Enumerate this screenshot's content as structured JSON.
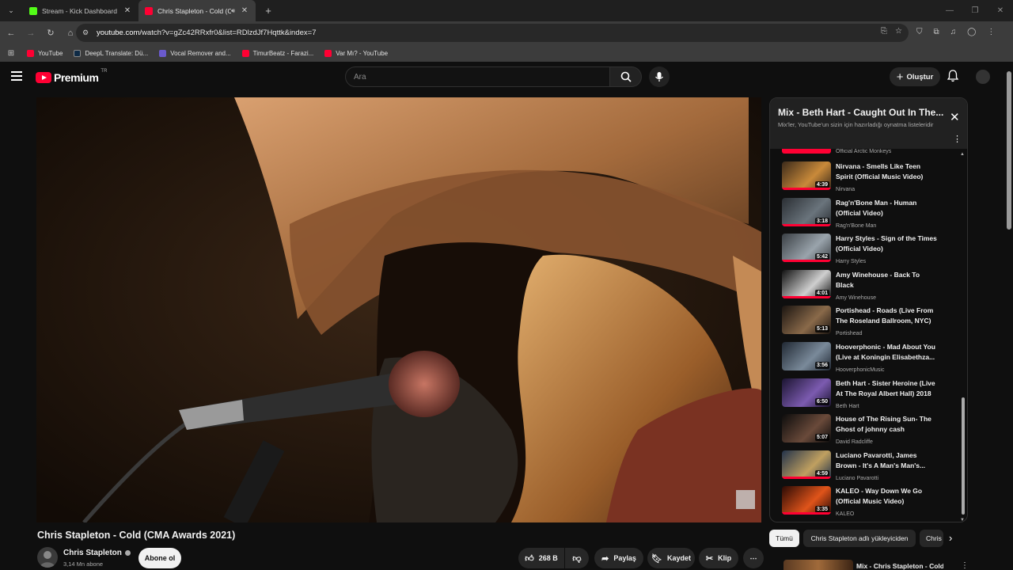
{
  "browser": {
    "tabs": [
      {
        "title": "Stream - Kick Dashboard",
        "color": "#53fc18"
      },
      {
        "title": "Chris Stapleton - Cold (CM",
        "color": "#ff0033",
        "active": true
      }
    ],
    "url_host": "youtube.com",
    "url_path": "/watch?v=gZc42RRxfr0&list=RDlzdJf7Hqttk&index=7",
    "bookmarks": [
      {
        "label": "YouTube",
        "color": "#ff0033"
      },
      {
        "label": "DeepL Translate: Dü...",
        "color": "#0f2b46"
      },
      {
        "label": "Vocal Remover and...",
        "color": "#6a5acd"
      },
      {
        "label": "TimurBeatz - Farazi...",
        "color": "#ff0033"
      },
      {
        "label": "Var Mı? - YouTube",
        "color": "#ff0033"
      }
    ]
  },
  "youtube": {
    "logo_text": "Premium",
    "country": "TR",
    "search_placeholder": "Ara",
    "create_label": "Oluştur"
  },
  "video": {
    "title": "Chris Stapleton - Cold (CMA Awards 2021)",
    "channel": "Chris Stapleton",
    "subscribers": "3,14 Mn abone",
    "subscribe_label": "Abone ol",
    "likes": "268 B",
    "share_label": "Paylaş",
    "save_label": "Kaydet",
    "clip_label": "Klip"
  },
  "playlist": {
    "title": "Mix - Beth Hart - Caught Out In The...",
    "subtitle": "Mix'ler, YouTube'un sizin için hazırladığı oynatma listeleridir",
    "partial_channel": "Official Arctic Monkeys",
    "items": [
      {
        "title": "Nirvana - Smells Like Teen Spirit (Official Music Video)",
        "channel": "Nirvana",
        "duration": "4:39",
        "progress": 1.0
      },
      {
        "title": "Rag'n'Bone Man - Human (Official Video)",
        "channel": "Rag'n'Bone Man",
        "duration": "3:18",
        "progress": 1.0
      },
      {
        "title": "Harry Styles - Sign of the Times (Official Video)",
        "channel": "Harry Styles",
        "duration": "5:42",
        "progress": 1.0
      },
      {
        "title": "Amy Winehouse - Back To Black",
        "channel": "Amy Winehouse",
        "duration": "4:01",
        "progress": 1.0
      },
      {
        "title": "Portishead - Roads (Live From The Roseland Ballroom, NYC)",
        "channel": "Portishead",
        "duration": "5:13",
        "progress": 0.0
      },
      {
        "title": "Hooverphonic - Mad About You (Live at Koningin Elisabethza...",
        "channel": "HooverphonicMusic",
        "duration": "3:56",
        "progress": 0.0
      },
      {
        "title": "Beth Hart - Sister Heroine (Live At The Royal Albert Hall) 2018",
        "channel": "Beth Hart",
        "duration": "6:50",
        "progress": 0.0
      },
      {
        "title": "House of The Rising Sun- The Ghost of johnny cash",
        "channel": "David Radcliffe",
        "duration": "5:07",
        "progress": 0.0
      },
      {
        "title": "Luciano Pavarotti, James Brown - It's A Man's Man's...",
        "channel": "Luciano Pavarotti",
        "duration": "4:59",
        "progress": 1.0
      },
      {
        "title": "KALEO - Way Down We Go (Official Music Video)",
        "channel": "KALEO",
        "duration": "3:35",
        "progress": 1.0
      }
    ]
  },
  "chips": [
    "Tümü",
    "Chris Stapleton adlı yükleyiciden",
    "Chris"
  ],
  "recommendation": {
    "title": "Mix - Chris Stapleton - Cold"
  }
}
